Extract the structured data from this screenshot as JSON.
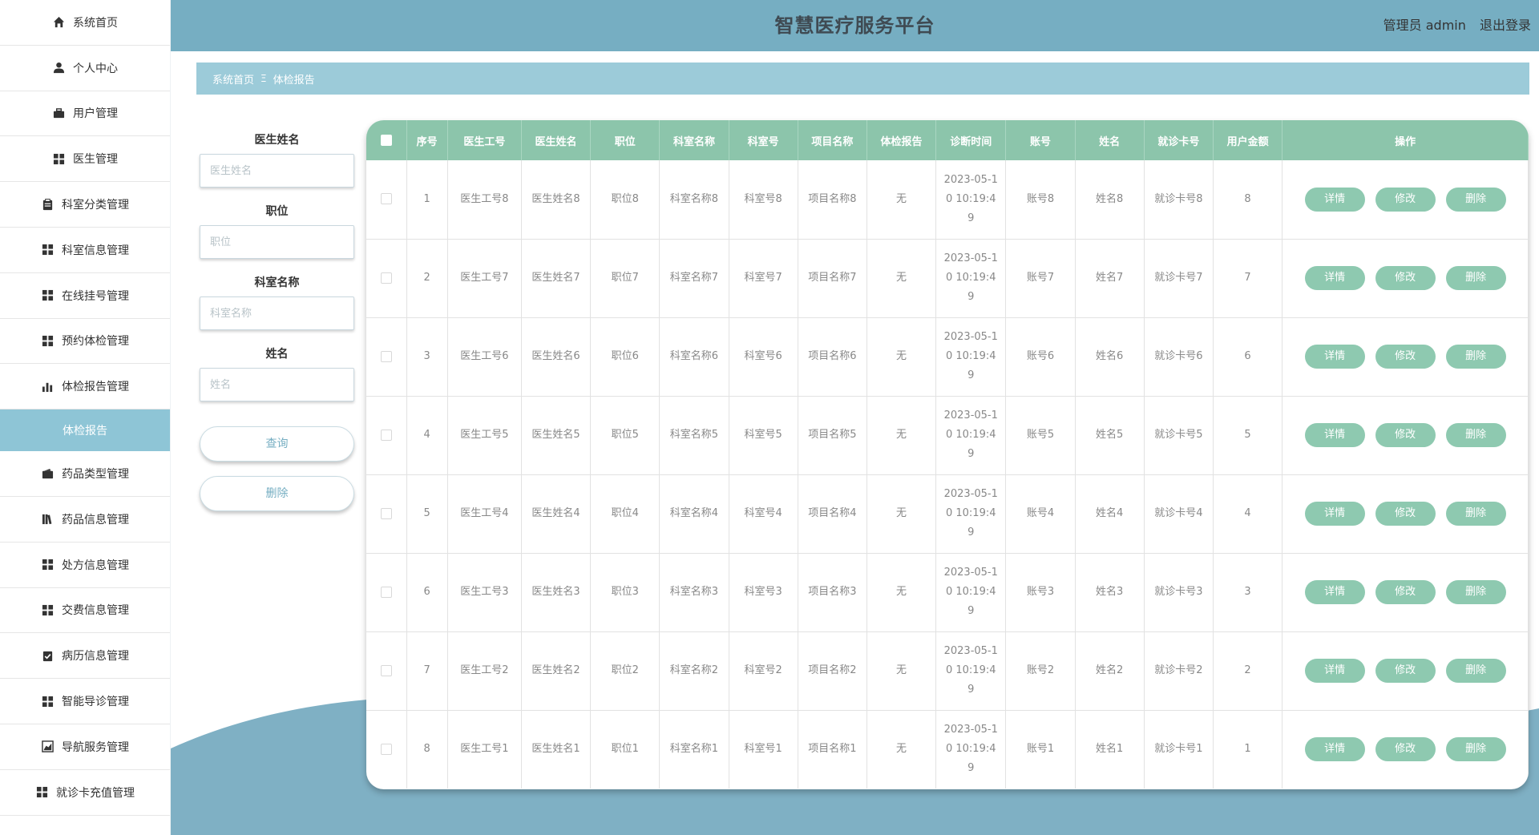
{
  "header": {
    "title": "智慧医疗服务平台",
    "user": "管理员 admin",
    "logout": "退出登录"
  },
  "sidebar": {
    "items": [
      {
        "label": "系统首页",
        "icon": "home-icon"
      },
      {
        "label": "个人中心",
        "icon": "user-icon"
      },
      {
        "label": "用户管理",
        "icon": "briefcase-icon"
      },
      {
        "label": "医生管理",
        "icon": "grid-icon"
      },
      {
        "label": "科室分类管理",
        "icon": "clipboard-icon"
      },
      {
        "label": "科室信息管理",
        "icon": "grid-icon"
      },
      {
        "label": "在线挂号管理",
        "icon": "grid-icon"
      },
      {
        "label": "预约体检管理",
        "icon": "grid-icon"
      },
      {
        "label": "体检报告管理",
        "icon": "bar-chart-icon"
      },
      {
        "label": "药品类型管理",
        "icon": "wallet-icon"
      },
      {
        "label": "药品信息管理",
        "icon": "books-icon"
      },
      {
        "label": "处方信息管理",
        "icon": "grid-icon"
      },
      {
        "label": "交费信息管理",
        "icon": "grid-icon"
      },
      {
        "label": "病历信息管理",
        "icon": "clipboard-check-icon"
      },
      {
        "label": "智能导诊管理",
        "icon": "grid-icon"
      },
      {
        "label": "导航服务管理",
        "icon": "area-chart-icon"
      },
      {
        "label": "就诊卡充值管理",
        "icon": "grid-icon"
      }
    ],
    "active_sub": "体检报告"
  },
  "breadcrumb": {
    "home": "系统首页",
    "sep": "Ξ",
    "current": "体检报告"
  },
  "search": {
    "fields": [
      {
        "label": "医生姓名",
        "placeholder": "医生姓名"
      },
      {
        "label": "职位",
        "placeholder": "职位"
      },
      {
        "label": "科室名称",
        "placeholder": "科室名称"
      },
      {
        "label": "姓名",
        "placeholder": "姓名"
      }
    ],
    "query_btn": "查询",
    "delete_btn": "删除"
  },
  "table": {
    "headers": [
      "序号",
      "医生工号",
      "医生姓名",
      "职位",
      "科室名称",
      "科室号",
      "项目名称",
      "体检报告",
      "诊断时间",
      "账号",
      "姓名",
      "就诊卡号",
      "用户金额",
      "操作"
    ],
    "rows": [
      {
        "no": "1",
        "doc_id": "医生工号8",
        "doc_name": "医生姓名8",
        "position": "职位8",
        "dept_name": "科室名称8",
        "dept_no": "科室号8",
        "item": "项目名称8",
        "report": "无",
        "time": "2023-05-10 10:19:49",
        "account": "账号8",
        "name": "姓名8",
        "card": "就诊卡号8",
        "amount": "8"
      },
      {
        "no": "2",
        "doc_id": "医生工号7",
        "doc_name": "医生姓名7",
        "position": "职位7",
        "dept_name": "科室名称7",
        "dept_no": "科室号7",
        "item": "项目名称7",
        "report": "无",
        "time": "2023-05-10 10:19:49",
        "account": "账号7",
        "name": "姓名7",
        "card": "就诊卡号7",
        "amount": "7"
      },
      {
        "no": "3",
        "doc_id": "医生工号6",
        "doc_name": "医生姓名6",
        "position": "职位6",
        "dept_name": "科室名称6",
        "dept_no": "科室号6",
        "item": "项目名称6",
        "report": "无",
        "time": "2023-05-10 10:19:49",
        "account": "账号6",
        "name": "姓名6",
        "card": "就诊卡号6",
        "amount": "6"
      },
      {
        "no": "4",
        "doc_id": "医生工号5",
        "doc_name": "医生姓名5",
        "position": "职位5",
        "dept_name": "科室名称5",
        "dept_no": "科室号5",
        "item": "项目名称5",
        "report": "无",
        "time": "2023-05-10 10:19:49",
        "account": "账号5",
        "name": "姓名5",
        "card": "就诊卡号5",
        "amount": "5"
      },
      {
        "no": "5",
        "doc_id": "医生工号4",
        "doc_name": "医生姓名4",
        "position": "职位4",
        "dept_name": "科室名称4",
        "dept_no": "科室号4",
        "item": "项目名称4",
        "report": "无",
        "time": "2023-05-10 10:19:49",
        "account": "账号4",
        "name": "姓名4",
        "card": "就诊卡号4",
        "amount": "4"
      },
      {
        "no": "6",
        "doc_id": "医生工号3",
        "doc_name": "医生姓名3",
        "position": "职位3",
        "dept_name": "科室名称3",
        "dept_no": "科室号3",
        "item": "项目名称3",
        "report": "无",
        "time": "2023-05-10 10:19:49",
        "account": "账号3",
        "name": "姓名3",
        "card": "就诊卡号3",
        "amount": "3"
      },
      {
        "no": "7",
        "doc_id": "医生工号2",
        "doc_name": "医生姓名2",
        "position": "职位2",
        "dept_name": "科室名称2",
        "dept_no": "科室号2",
        "item": "项目名称2",
        "report": "无",
        "time": "2023-05-10 10:19:49",
        "account": "账号2",
        "name": "姓名2",
        "card": "就诊卡号2",
        "amount": "2"
      },
      {
        "no": "8",
        "doc_id": "医生工号1",
        "doc_name": "医生姓名1",
        "position": "职位1",
        "dept_name": "科室名称1",
        "dept_no": "科室号1",
        "item": "项目名称1",
        "report": "无",
        "time": "2023-05-10 10:19:49",
        "account": "账号1",
        "name": "姓名1",
        "card": "就诊卡号1",
        "amount": "1"
      }
    ],
    "actions": {
      "detail": "详情",
      "edit": "修改",
      "delete": "删除"
    }
  },
  "colors": {
    "header_bg": "#76aec2",
    "accent_green": "#8cc5ab",
    "active_sub": "#8ec5d6",
    "wave": "#7fb0c4"
  }
}
